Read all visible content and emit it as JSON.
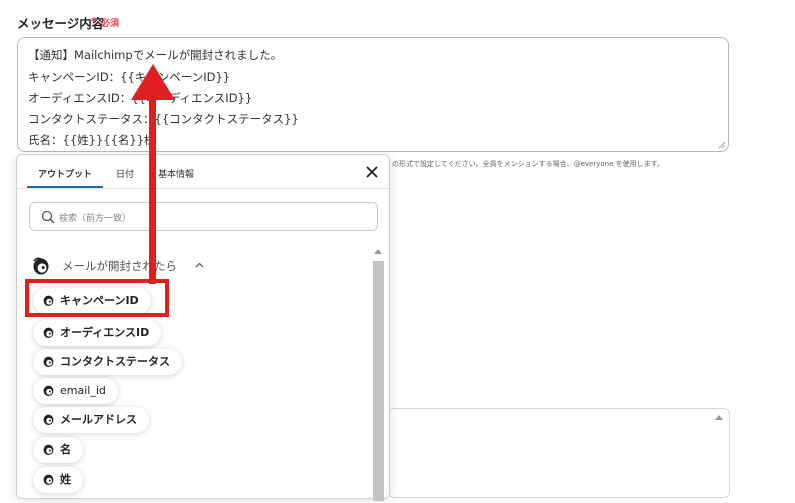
{
  "form": {
    "label": "メッセージ内容",
    "required_star": "*",
    "required_text": "必須",
    "message_lines": [
      "【通知】Mailchimpでメールが開封されました。",
      "キャンペーンID：{{キャンペーンID}}",
      "オーディエンスID：{{オーディエンスID}}",
      "コンタクトステータス：{{コンタクトステータス}}",
      "氏名：{{姓}}{{名}}様"
    ],
    "helper_text": "の形式で設定してください。全員をメンションする場合、@everyone を使用します。"
  },
  "panel": {
    "tabs": [
      {
        "label": "アウトプット",
        "active": true
      },
      {
        "label": "日付",
        "active": false
      },
      {
        "label": "基本情報",
        "active": false
      }
    ],
    "search_placeholder": "検索（前方一致）",
    "group_title": "メールが開封されたら",
    "items": [
      {
        "label": "キャンペーンID"
      },
      {
        "label": "オーディエンスID"
      },
      {
        "label": "コンタクトステータス"
      },
      {
        "label": "email_id"
      },
      {
        "label": "メールアドレス"
      },
      {
        "label": "名"
      },
      {
        "label": "姓"
      }
    ]
  },
  "colors": {
    "accent_blue": "#1f6fb2",
    "required_red": "#e8455c",
    "annotation_red": "#e02020"
  },
  "icons": {
    "close": "close-icon",
    "search": "search-icon",
    "mailchimp": "mailchimp-logo-icon",
    "chevron": "chevron-up-icon"
  }
}
